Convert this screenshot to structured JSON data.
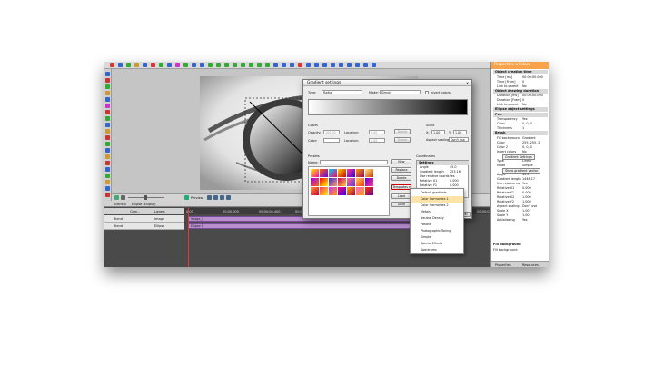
{
  "app": {
    "properties": {
      "title": "Properties window",
      "sections": [
        {
          "header": "Object creation time",
          "rows": [
            [
              "Time [ms]",
              "00:00:00.000"
            ],
            [
              "Time [Fram]",
              "0"
            ],
            [
              "Link to parent",
              "No"
            ]
          ]
        },
        {
          "header": "Object drawing duration",
          "rows": [
            [
              "Duration [ms]",
              "00:00:00.000"
            ],
            [
              "Duration [Fram]",
              "0"
            ],
            [
              "Link to parent",
              "No"
            ]
          ]
        },
        {
          "header": "Ellipse object settings",
          "rows": []
        },
        {
          "header": "Pen",
          "rows": [
            [
              "Transparency",
              "Yes"
            ],
            [
              "Color",
              "0, 0, 0"
            ],
            [
              "Thickness",
              "1"
            ]
          ]
        },
        {
          "header": "Brush",
          "rows": [
            [
              "Fill background",
              "Gradient"
            ],
            [
              "Color",
              "255, 255, 2"
            ],
            [
              "Color 2",
              "0, 0, 0"
            ],
            [
              "Invert colors",
              "No"
            ],
            [
              "",
              "Gradient Settings"
            ],
            [
              "Type",
              "Linear"
            ],
            [
              "Mode",
              "Simple"
            ],
            [
              "",
              "Show gradient vector"
            ],
            [
              "Angle",
              "45.0"
            ],
            [
              "Gradient length",
              "1448.17"
            ],
            [
              "Use relative co",
              "Yes"
            ],
            [
              "Relative X1",
              "0.000"
            ],
            [
              "Relative Y1",
              "0.000"
            ],
            [
              "Relative X2",
              "1.000"
            ],
            [
              "Relative Y2",
              "1.000"
            ],
            [
              "Aspect scaling",
              "Don't use"
            ],
            [
              "Scale X",
              "1.00"
            ],
            [
              "Scale Y",
              "1.00"
            ],
            [
              "Antialiasing",
              "Yes"
            ]
          ]
        }
      ],
      "footer_title": "Fill background",
      "footer_text": "Fill background",
      "tabs": [
        "Properties",
        "Resources"
      ]
    },
    "transport": {
      "preview": "Preview"
    },
    "timeline": {
      "scene": "Scene 0",
      "object": "Ellipse (Ellipse)",
      "columns": [
        "Com...",
        "Layers"
      ],
      "ruler": [
        "0:00",
        "00:00.000",
        "00:00:00.400",
        "00:00:00.800",
        "00:00:01.200",
        "00:00:01.600",
        "00:00:02.000",
        "00:00:02.400",
        "00:00:02.800"
      ],
      "rows": [
        {
          "mode": "Blend",
          "type": "Image",
          "clip": "image_1"
        },
        {
          "mode": "Blend",
          "type": "Ellipse",
          "clip": "Ellipse 1"
        }
      ]
    }
  },
  "dialog": {
    "title": "Gradient settings",
    "type_label": "Type:",
    "type_value": "Radial",
    "mode_label": "Mode:",
    "mode_value": "Simple",
    "invert_label": "Invert colors",
    "colors_label": "Colors",
    "opacity_label": "Opacity:",
    "opacity_value": "100.00",
    "location_label": "Location:",
    "location_value": "0.00",
    "color_label": "Color:",
    "delete_label": "Delete",
    "scale_label": "Scale",
    "sx_label": "X:",
    "sx_value": "1.00",
    "sy_label": "Y:",
    "sy_value": "1.00",
    "aspect_label": "Aspect scaling:",
    "aspect_value": "Don't use",
    "presets_label": "Presets",
    "name_label": "Name:",
    "coords_label": "Coordinates",
    "settings_header": "Settings",
    "settings": [
      [
        "Angle",
        "45.0"
      ],
      [
        "Gradient length",
        "253.16"
      ],
      [
        "Use relative coords",
        "Yes"
      ],
      [
        "Relative X1",
        "0.000"
      ],
      [
        "Relative Y1",
        "0.000"
      ],
      [
        "Relative X2",
        "1.000"
      ],
      [
        "Relative Y2",
        "1.000"
      ]
    ],
    "buttons": {
      "new": "New",
      "replace": "Replace",
      "delete": "Delete",
      "templates": "Templates",
      "load": "Load",
      "save": "Save",
      "ok": "OK",
      "cancel": "Cancel"
    },
    "templates_menu": [
      "Default gradients",
      "Color Harmonies 1",
      "Color Harmonies 2",
      "Metals",
      "Neutral Density",
      "Pastels",
      "Photographic Toning",
      "Simple",
      "Special Effects",
      "Spectrums"
    ],
    "menu_highlighted_index": 1,
    "colors": {
      "accent": "#f6a34b",
      "highlight_border": "#cc0000"
    }
  }
}
